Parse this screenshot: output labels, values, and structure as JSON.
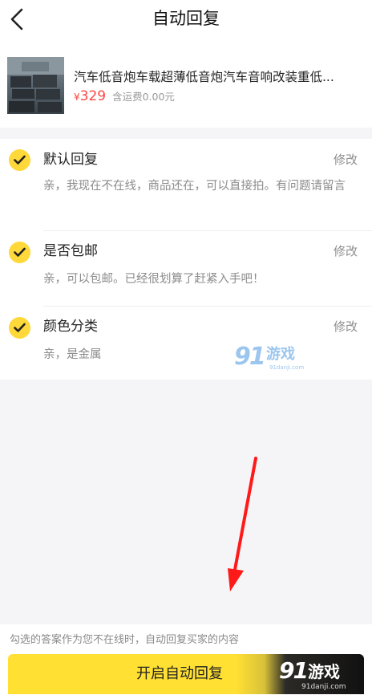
{
  "header": {
    "title": "自动回复",
    "back_icon": "chevron-left-icon"
  },
  "product": {
    "title": "汽车低音炮车载超薄低音炮汽车音响改装重低...",
    "price_symbol": "¥",
    "price": "329",
    "shipping": "含运费0.00元"
  },
  "replies": [
    {
      "title": "默认回复",
      "edit": "修改",
      "text": "亲，我现在不在线，商品还在，可以直接拍。有问题请留言",
      "checked": true
    },
    {
      "title": "是否包邮",
      "edit": "修改",
      "text": "亲，可以包邮。已经很划算了赶紧入手吧！",
      "checked": true
    },
    {
      "title": "颜色分类",
      "edit": "修改",
      "text": "亲，是金属",
      "checked": true
    }
  ],
  "watermark": {
    "logo": "91",
    "name": "游戏",
    "url": "91danji.com"
  },
  "footer": {
    "note": "勾选的答案作为您不在线时，自动回复买家的内容",
    "button_label": "开启自动回复",
    "logo": "91",
    "logo_name": "游戏",
    "logo_url": "91danji.com"
  },
  "colors": {
    "accent": "#ffd83a",
    "price": "#ff4444",
    "annotation_arrow": "#ff1a1a"
  }
}
